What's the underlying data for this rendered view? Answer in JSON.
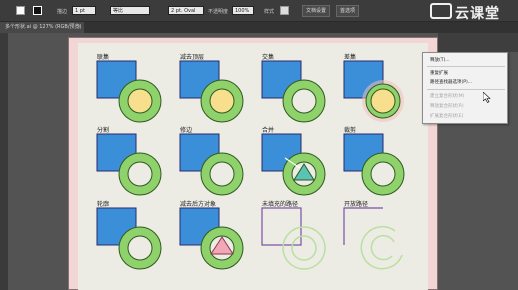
{
  "control_bar": {
    "opacity_label": "描边",
    "stroke_weight": "1 pt",
    "stroke_style": "等比",
    "profile": "2 pt. Oval",
    "transparency_label": "不透明度",
    "transparency_value": "100%",
    "style_label": "样式",
    "doc_setup": "文档设置",
    "prefs": "首选项"
  },
  "document_tab": {
    "title": "多个形状.ai @ 127% (RGB/预览)",
    "close": "×"
  },
  "brand": {
    "name": "云课堂"
  },
  "cells": [
    {
      "label": "联集"
    },
    {
      "label": "减去顶层"
    },
    {
      "label": "交集"
    },
    {
      "label": "差集"
    },
    {
      "label": "分割"
    },
    {
      "label": "修边"
    },
    {
      "label": "合并"
    },
    {
      "label": "裁剪"
    },
    {
      "label": "轮廓"
    },
    {
      "label": "减去后方对象"
    },
    {
      "label": "未填充的路径"
    },
    {
      "label": "开放路径"
    }
  ],
  "context_menu": {
    "items": [
      {
        "label": "释放(T)...",
        "enabled": true
      },
      {
        "label": "重复扩展",
        "enabled": true
      },
      {
        "label": "路径查找器选项(P)...",
        "enabled": true
      },
      {
        "label": "建立复合形状(M)",
        "enabled": false
      },
      {
        "label": "释放复合形状(R)",
        "enabled": false
      },
      {
        "label": "扩展复合形状(E)",
        "enabled": false
      }
    ]
  },
  "colors": {
    "square_fill": "#3b8fd9",
    "square_stroke": "#2a2a6e",
    "ring_green": "#8fd16a",
    "ring_stroke": "#2e5a20",
    "circle_yellow": "#f7df8e",
    "triangle_teal": "#59c4b4",
    "triangle_pink": "#f3a6b6",
    "outline_purple": "#7b4fa6"
  }
}
